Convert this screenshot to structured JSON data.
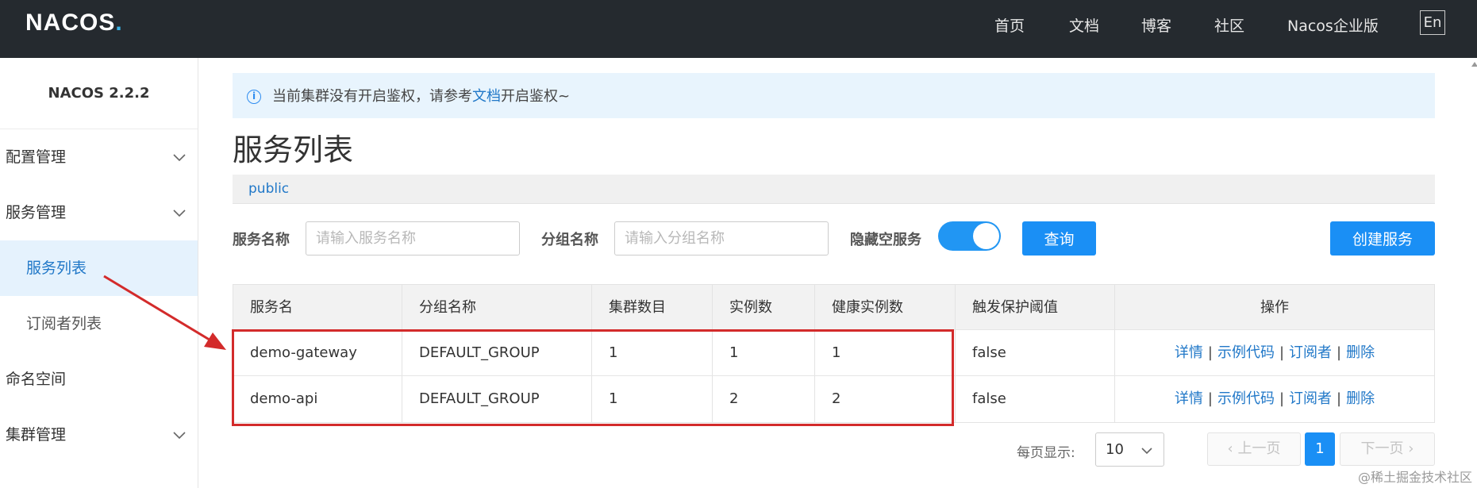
{
  "header": {
    "logo_text": "NACOS",
    "logo_dot": ".",
    "nav": [
      "首页",
      "文档",
      "博客",
      "社区",
      "Nacos企业版"
    ],
    "lang": "En"
  },
  "sidebar": {
    "version": "NACOS 2.2.2",
    "items": [
      {
        "label": "配置管理",
        "expandable": true
      },
      {
        "label": "服务管理",
        "expandable": true
      },
      {
        "label": "服务列表",
        "sub": true,
        "active": true
      },
      {
        "label": "订阅者列表",
        "sub": true
      },
      {
        "label": "命名空间"
      },
      {
        "label": "集群管理",
        "expandable": true
      }
    ]
  },
  "notice": {
    "prefix": "当前集群没有开启鉴权，请参考",
    "link": "文档",
    "suffix": "开启鉴权~"
  },
  "page_title": "服务列表",
  "namespace": "public",
  "filters": {
    "service_name_label": "服务名称",
    "service_name_placeholder": "请输入服务名称",
    "service_name_value": "",
    "group_name_label": "分组名称",
    "group_name_placeholder": "请输入分组名称",
    "group_name_value": "",
    "hide_empty_label": "隐藏空服务",
    "hide_empty_on": true,
    "query_label": "查询",
    "create_label": "创建服务"
  },
  "table": {
    "columns": [
      "服务名",
      "分组名称",
      "集群数目",
      "实例数",
      "健康实例数",
      "触发保护阈值",
      "操作"
    ],
    "rows": [
      {
        "name": "demo-gateway",
        "group": "DEFAULT_GROUP",
        "clusters": "1",
        "instances": "1",
        "healthy": "1",
        "threshold": "false"
      },
      {
        "name": "demo-api",
        "group": "DEFAULT_GROUP",
        "clusters": "1",
        "instances": "2",
        "healthy": "2",
        "threshold": "false"
      }
    ],
    "actions": [
      "详情",
      "示例代码",
      "订阅者",
      "删除"
    ],
    "action_separator": "|"
  },
  "pagination": {
    "page_size_label": "每页显示:",
    "page_size": "10",
    "prev_label": "上一页",
    "next_label": "下一页",
    "current_page": "1"
  },
  "watermark": "@稀土掘金技术社区",
  "colors": {
    "topbar": "#252a2f",
    "accent": "#1a8ff5",
    "link": "#2178c8",
    "annotation": "#d32b2b"
  }
}
